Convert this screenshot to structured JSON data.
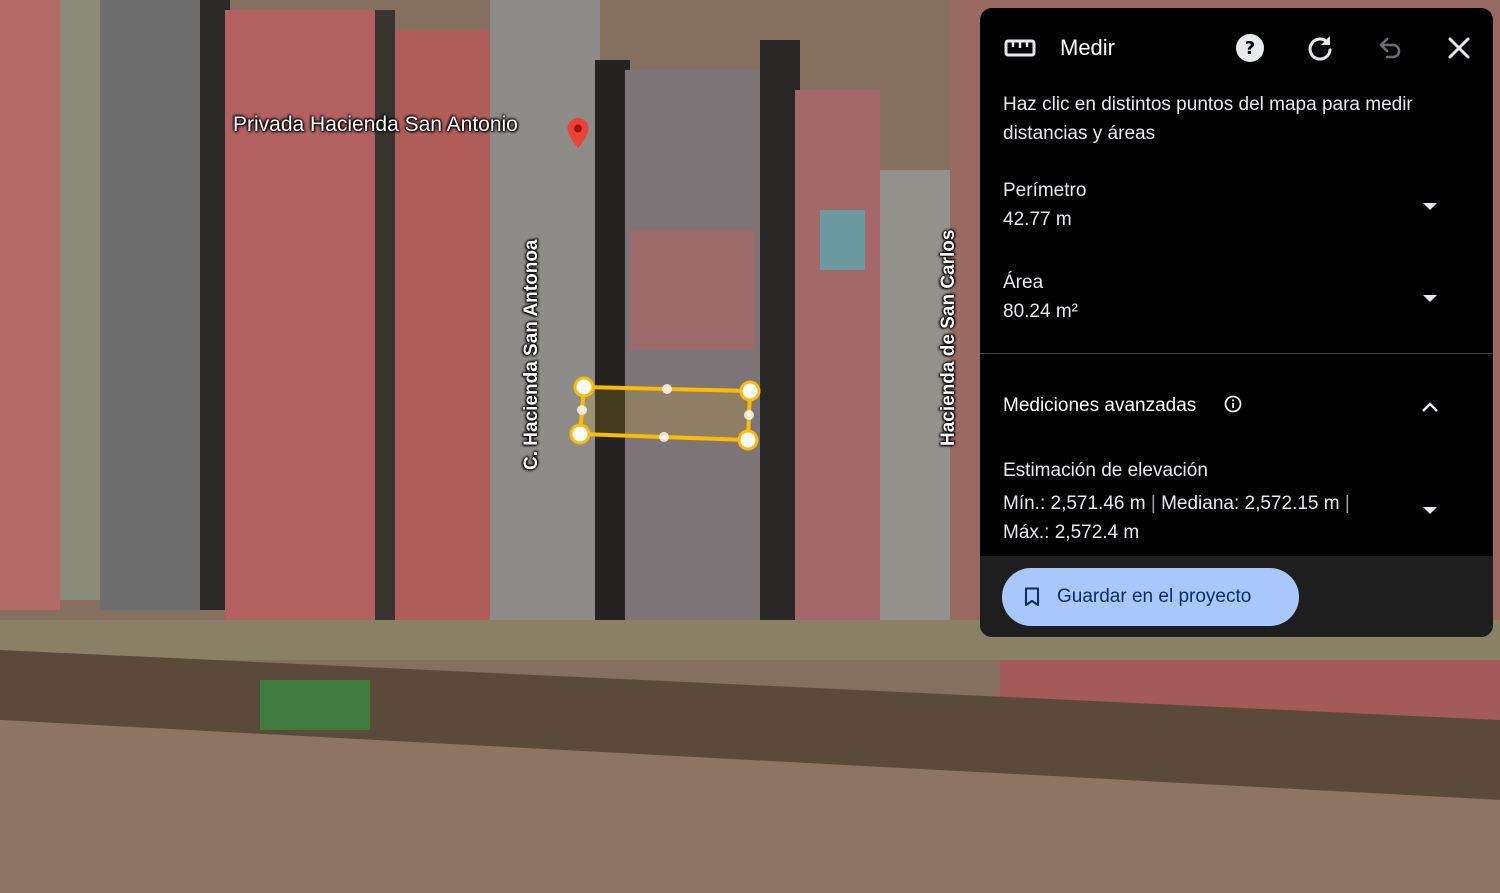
{
  "map": {
    "place_label": "Privada Hacienda San Antonio",
    "streets": [
      "C. Hacienda San Antonoa",
      "Hacienda de San Carlos"
    ],
    "measure_color": "#fbbc04",
    "pin_color": "#ea4335"
  },
  "panel": {
    "title": "Medir",
    "icons": {
      "ruler": "ruler-icon",
      "help": "help-icon",
      "refresh": "refresh-icon",
      "undo": "undo-icon",
      "close": "close-icon"
    },
    "instructions": "Haz clic en distintos puntos del mapa para medir distancias y áreas",
    "perimeter": {
      "label": "Perímetro",
      "value": "42.77 m"
    },
    "area": {
      "label": "Área",
      "value": "80.24 m²"
    },
    "advanced": {
      "label": "Mediciones avanzadas"
    },
    "elevation": {
      "label": "Estimación de elevación",
      "min": "Mín.: 2,571.46 m",
      "median": "Mediana: 2,572.15 m",
      "max": "Máx.: 2,572.4 m"
    },
    "save_button": "Guardar en el proyecto"
  }
}
